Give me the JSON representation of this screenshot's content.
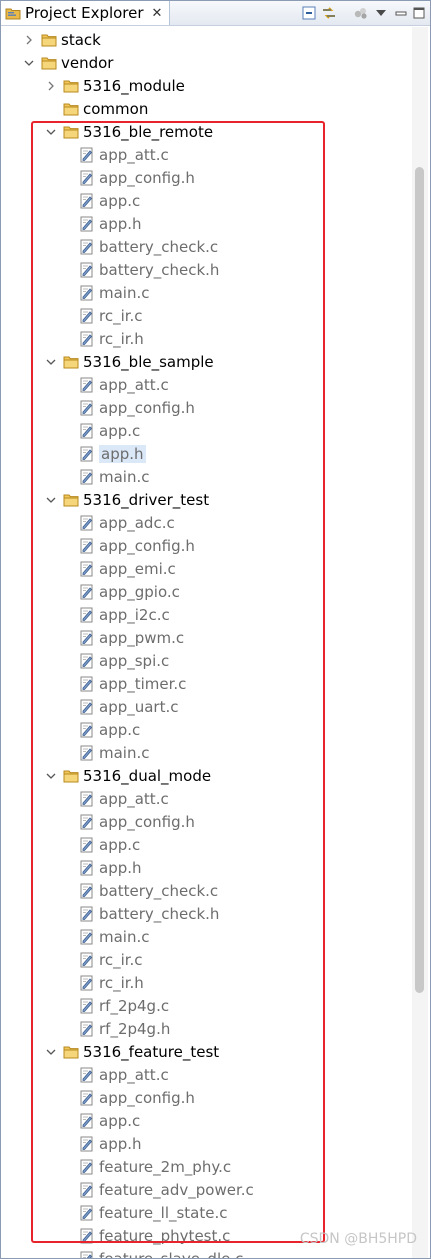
{
  "panel": {
    "title": "Project Explorer",
    "close": "✕"
  },
  "toolbar": {
    "buttons": [
      "collapse-all-icon",
      "link-with-editor-icon",
      "filters-icon",
      "view-menu-icon",
      "minimize-icon",
      "maximize-icon"
    ]
  },
  "tree": [
    {
      "label": "stack",
      "type": "folder",
      "depth": 0,
      "expanded": false
    },
    {
      "label": "vendor",
      "type": "folder",
      "depth": 0,
      "expanded": true
    },
    {
      "label": "5316_module",
      "type": "folder",
      "depth": 1,
      "expanded": false
    },
    {
      "label": "common",
      "type": "folder",
      "depth": 1,
      "expanded": false,
      "noArrow": true
    },
    {
      "label": "5316_ble_remote",
      "type": "folder",
      "depth": 1,
      "expanded": true
    },
    {
      "label": "app_att.c",
      "type": "file",
      "depth": 2
    },
    {
      "label": "app_config.h",
      "type": "file",
      "depth": 2
    },
    {
      "label": "app.c",
      "type": "file",
      "depth": 2
    },
    {
      "label": "app.h",
      "type": "file",
      "depth": 2
    },
    {
      "label": "battery_check.c",
      "type": "file",
      "depth": 2
    },
    {
      "label": "battery_check.h",
      "type": "file",
      "depth": 2
    },
    {
      "label": "main.c",
      "type": "file",
      "depth": 2
    },
    {
      "label": "rc_ir.c",
      "type": "file",
      "depth": 2
    },
    {
      "label": "rc_ir.h",
      "type": "file",
      "depth": 2
    },
    {
      "label": "5316_ble_sample",
      "type": "folder",
      "depth": 1,
      "expanded": true
    },
    {
      "label": "app_att.c",
      "type": "file",
      "depth": 2
    },
    {
      "label": "app_config.h",
      "type": "file",
      "depth": 2
    },
    {
      "label": "app.c",
      "type": "file",
      "depth": 2
    },
    {
      "label": "app.h",
      "type": "file",
      "depth": 2,
      "selected": true
    },
    {
      "label": "main.c",
      "type": "file",
      "depth": 2
    },
    {
      "label": "5316_driver_test",
      "type": "folder",
      "depth": 1,
      "expanded": true
    },
    {
      "label": "app_adc.c",
      "type": "file",
      "depth": 2
    },
    {
      "label": "app_config.h",
      "type": "file",
      "depth": 2
    },
    {
      "label": "app_emi.c",
      "type": "file",
      "depth": 2
    },
    {
      "label": "app_gpio.c",
      "type": "file",
      "depth": 2
    },
    {
      "label": "app_i2c.c",
      "type": "file",
      "depth": 2
    },
    {
      "label": "app_pwm.c",
      "type": "file",
      "depth": 2
    },
    {
      "label": "app_spi.c",
      "type": "file",
      "depth": 2
    },
    {
      "label": "app_timer.c",
      "type": "file",
      "depth": 2
    },
    {
      "label": "app_uart.c",
      "type": "file",
      "depth": 2
    },
    {
      "label": "app.c",
      "type": "file",
      "depth": 2
    },
    {
      "label": "main.c",
      "type": "file",
      "depth": 2
    },
    {
      "label": "5316_dual_mode",
      "type": "folder",
      "depth": 1,
      "expanded": true
    },
    {
      "label": "app_att.c",
      "type": "file",
      "depth": 2
    },
    {
      "label": "app_config.h",
      "type": "file",
      "depth": 2
    },
    {
      "label": "app.c",
      "type": "file",
      "depth": 2
    },
    {
      "label": "app.h",
      "type": "file",
      "depth": 2
    },
    {
      "label": "battery_check.c",
      "type": "file",
      "depth": 2
    },
    {
      "label": "battery_check.h",
      "type": "file",
      "depth": 2
    },
    {
      "label": "main.c",
      "type": "file",
      "depth": 2
    },
    {
      "label": "rc_ir.c",
      "type": "file",
      "depth": 2
    },
    {
      "label": "rc_ir.h",
      "type": "file",
      "depth": 2
    },
    {
      "label": "rf_2p4g.c",
      "type": "file",
      "depth": 2
    },
    {
      "label": "rf_2p4g.h",
      "type": "file",
      "depth": 2
    },
    {
      "label": "5316_feature_test",
      "type": "folder",
      "depth": 1,
      "expanded": true
    },
    {
      "label": "app_att.c",
      "type": "file",
      "depth": 2
    },
    {
      "label": "app_config.h",
      "type": "file",
      "depth": 2
    },
    {
      "label": "app.c",
      "type": "file",
      "depth": 2
    },
    {
      "label": "app.h",
      "type": "file",
      "depth": 2
    },
    {
      "label": "feature_2m_phy.c",
      "type": "file",
      "depth": 2
    },
    {
      "label": "feature_adv_power.c",
      "type": "file",
      "depth": 2
    },
    {
      "label": "feature_ll_state.c",
      "type": "file",
      "depth": 2
    },
    {
      "label": "feature_phytest.c",
      "type": "file",
      "depth": 2
    },
    {
      "label": "feature_slave_dle.c",
      "type": "file",
      "depth": 2
    }
  ],
  "watermark": "CSDN @BH5HPD",
  "colors": {
    "highlight_box": "#e8232b",
    "folder": "#e9b949",
    "file_text": "#6d6d6d"
  }
}
